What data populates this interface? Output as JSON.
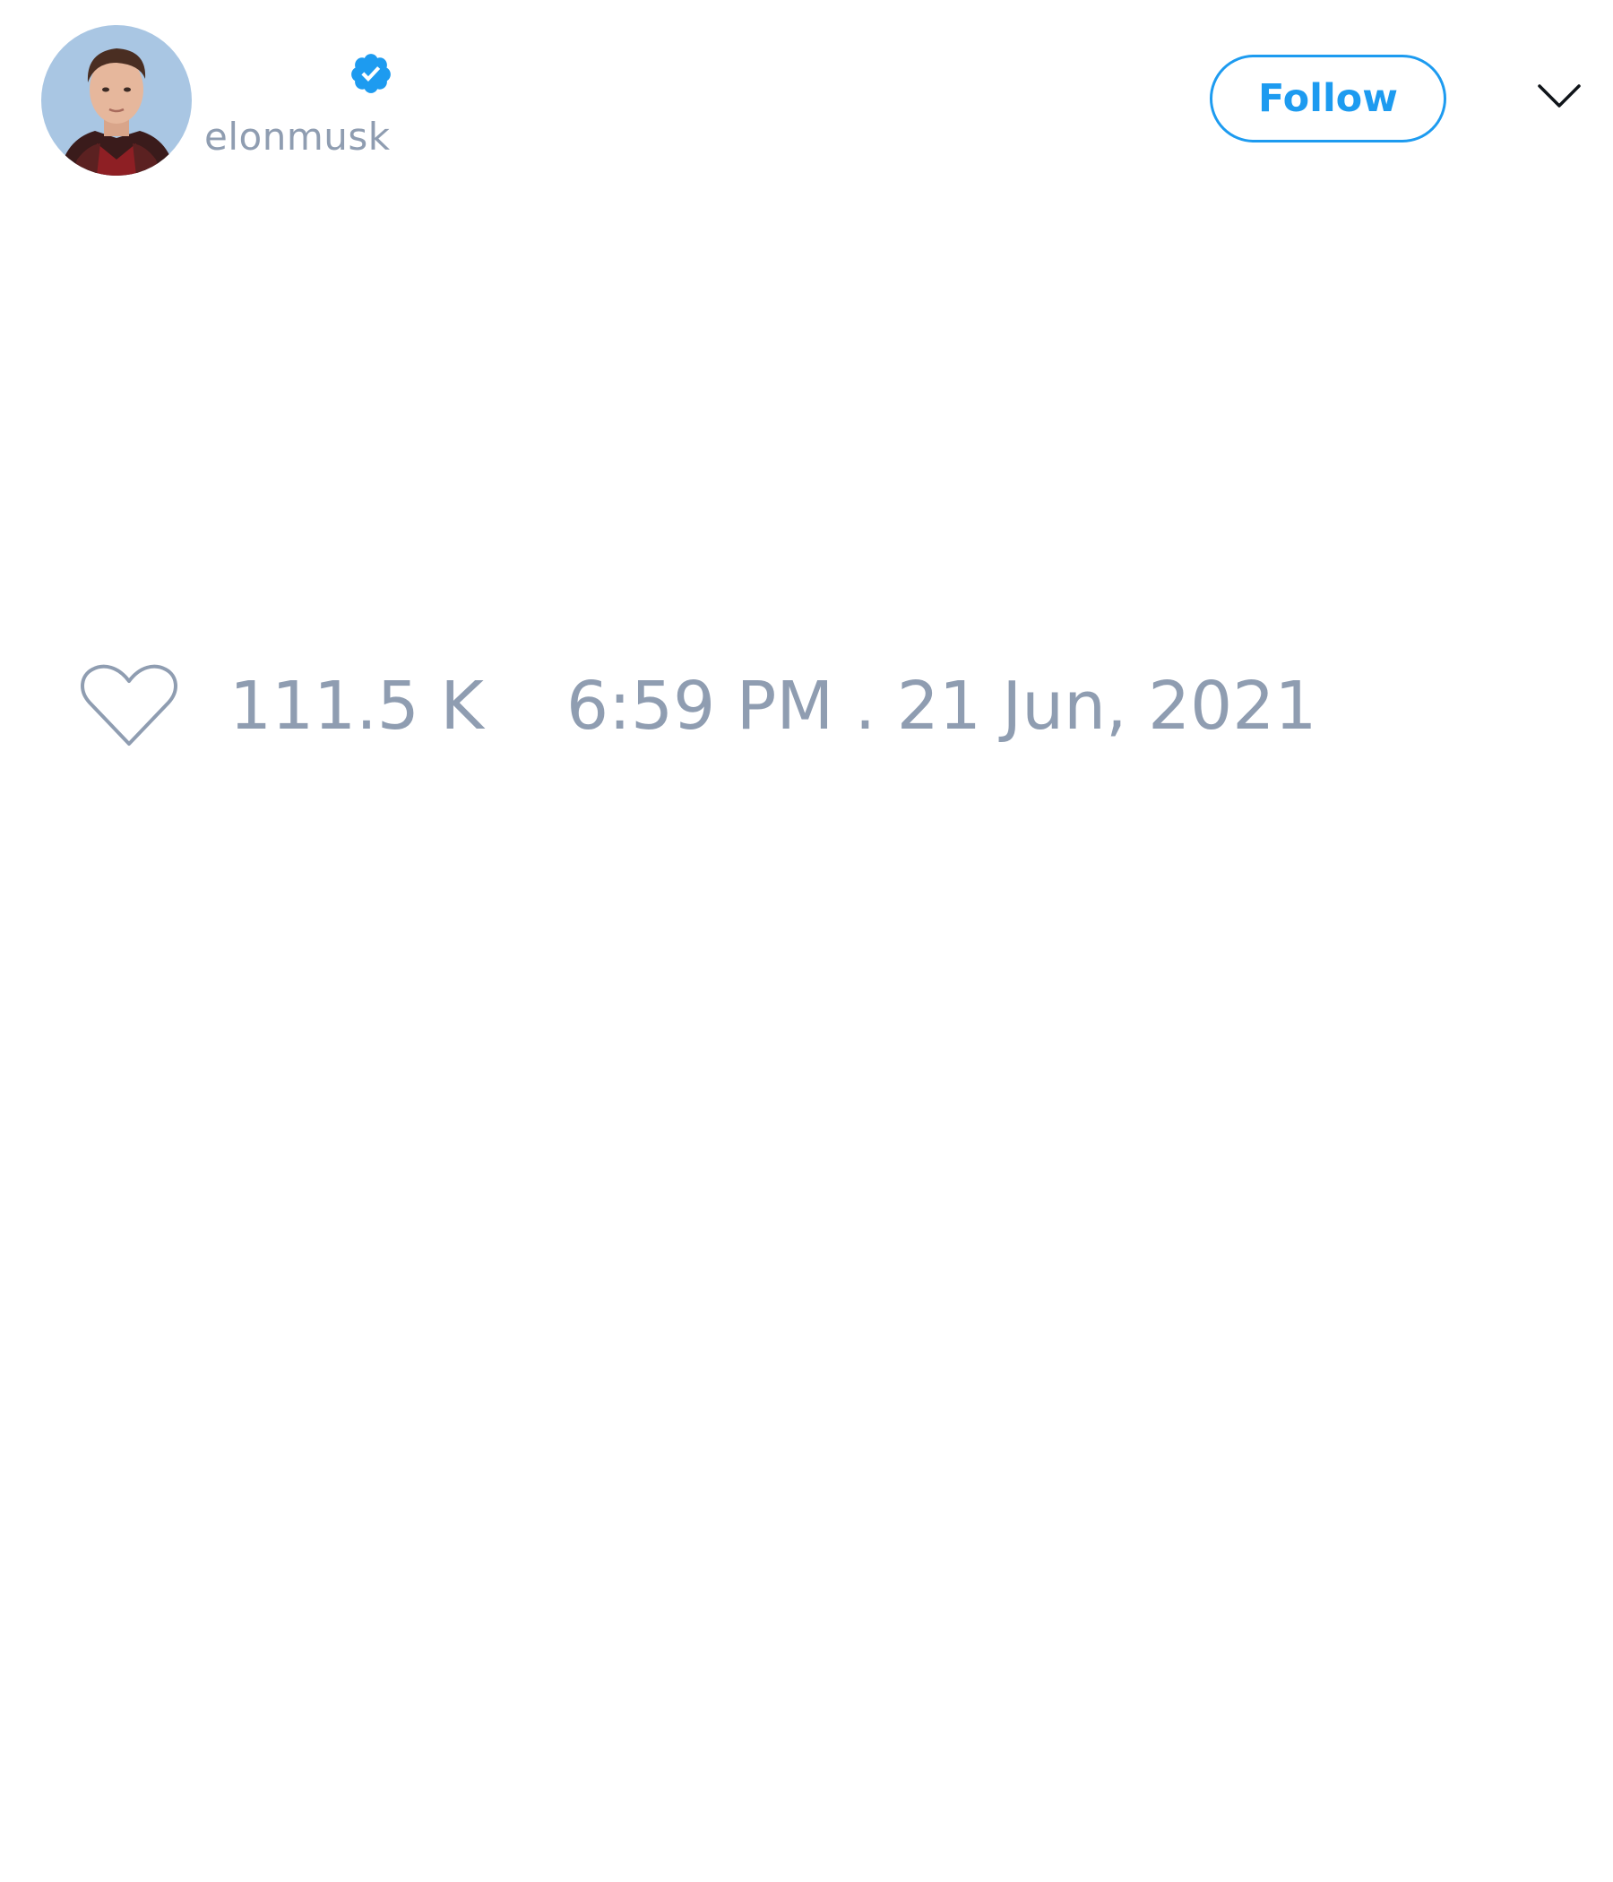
{
  "author": {
    "display_name": "",
    "handle": "elonmusk",
    "verified": true,
    "avatar_icon": "profile-photo"
  },
  "header": {
    "follow_label": "Follow",
    "more_icon": "chevron-down-icon"
  },
  "footer": {
    "like_icon": "heart-outline-icon",
    "like_count": "111.5 K",
    "timestamp": "6:59 PM . 21 Jun, 2021"
  },
  "colors": {
    "accent": "#1d9bf0",
    "muted_text": "#8f9db1",
    "background": "#ffffff"
  }
}
